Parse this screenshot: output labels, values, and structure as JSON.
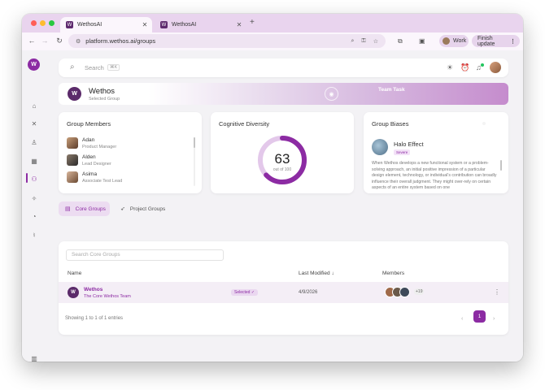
{
  "browser": {
    "tabs": [
      {
        "title": "WethosAI"
      },
      {
        "title": "WethosAI"
      }
    ],
    "url": "platform.wethos.ai/groups",
    "profile_label": "Work",
    "update_label": "Finish update"
  },
  "search": {
    "placeholder": "Search",
    "shortcut": "⌘K"
  },
  "group": {
    "name": "Wethos",
    "subtitle": "Selected Group",
    "banner_title": "Team Task"
  },
  "members_card": {
    "title": "Group Members",
    "members": [
      {
        "name": "Adan",
        "role": "Product Manager"
      },
      {
        "name": "Alden",
        "role": "Lead Designer"
      },
      {
        "name": "Asima",
        "role": "Associate Test Lead"
      }
    ]
  },
  "diversity_card": {
    "title": "Cognitive Diversity",
    "value": 63,
    "max": 100,
    "value_text": "63",
    "max_text": "out of 100"
  },
  "biases_card": {
    "title": "Group Biases",
    "bias_name": "Halo Effect",
    "bias_tag": "Severe",
    "description": "When Wethos develops a new functional system or a problem-solving approach, an initial positive impression of a particular design element, technology, or individual's contribution can broadly influence their overall judgment. They might over-rely on certain aspects of an entire system based on one"
  },
  "group_tabs": [
    {
      "label": "Core Groups"
    },
    {
      "label": "Project Groups"
    }
  ],
  "table": {
    "search_placeholder": "Search Core Groups",
    "columns": {
      "name": "Name",
      "last_modified": "Last Modified ↓",
      "members": "Members"
    },
    "rows": [
      {
        "name": "Wethos",
        "description": "The Core Wethos Team",
        "badge": "Selected ✓",
        "date": "4/9/2026",
        "more_members": "+19"
      }
    ],
    "footer": "Showing 1 to 1 of 1 entries",
    "current_page": "1"
  },
  "colors": {
    "accent": "#8c2ba3",
    "gauge_track": "#e3c8ea"
  },
  "icons": {
    "logo": "wethos-logo-icon",
    "sidebar": [
      "home-icon",
      "tools-icon",
      "person-icon",
      "calendar-icon",
      "groups-icon",
      "lightbulb-icon",
      "gauge-icon",
      "microphone-icon"
    ]
  }
}
